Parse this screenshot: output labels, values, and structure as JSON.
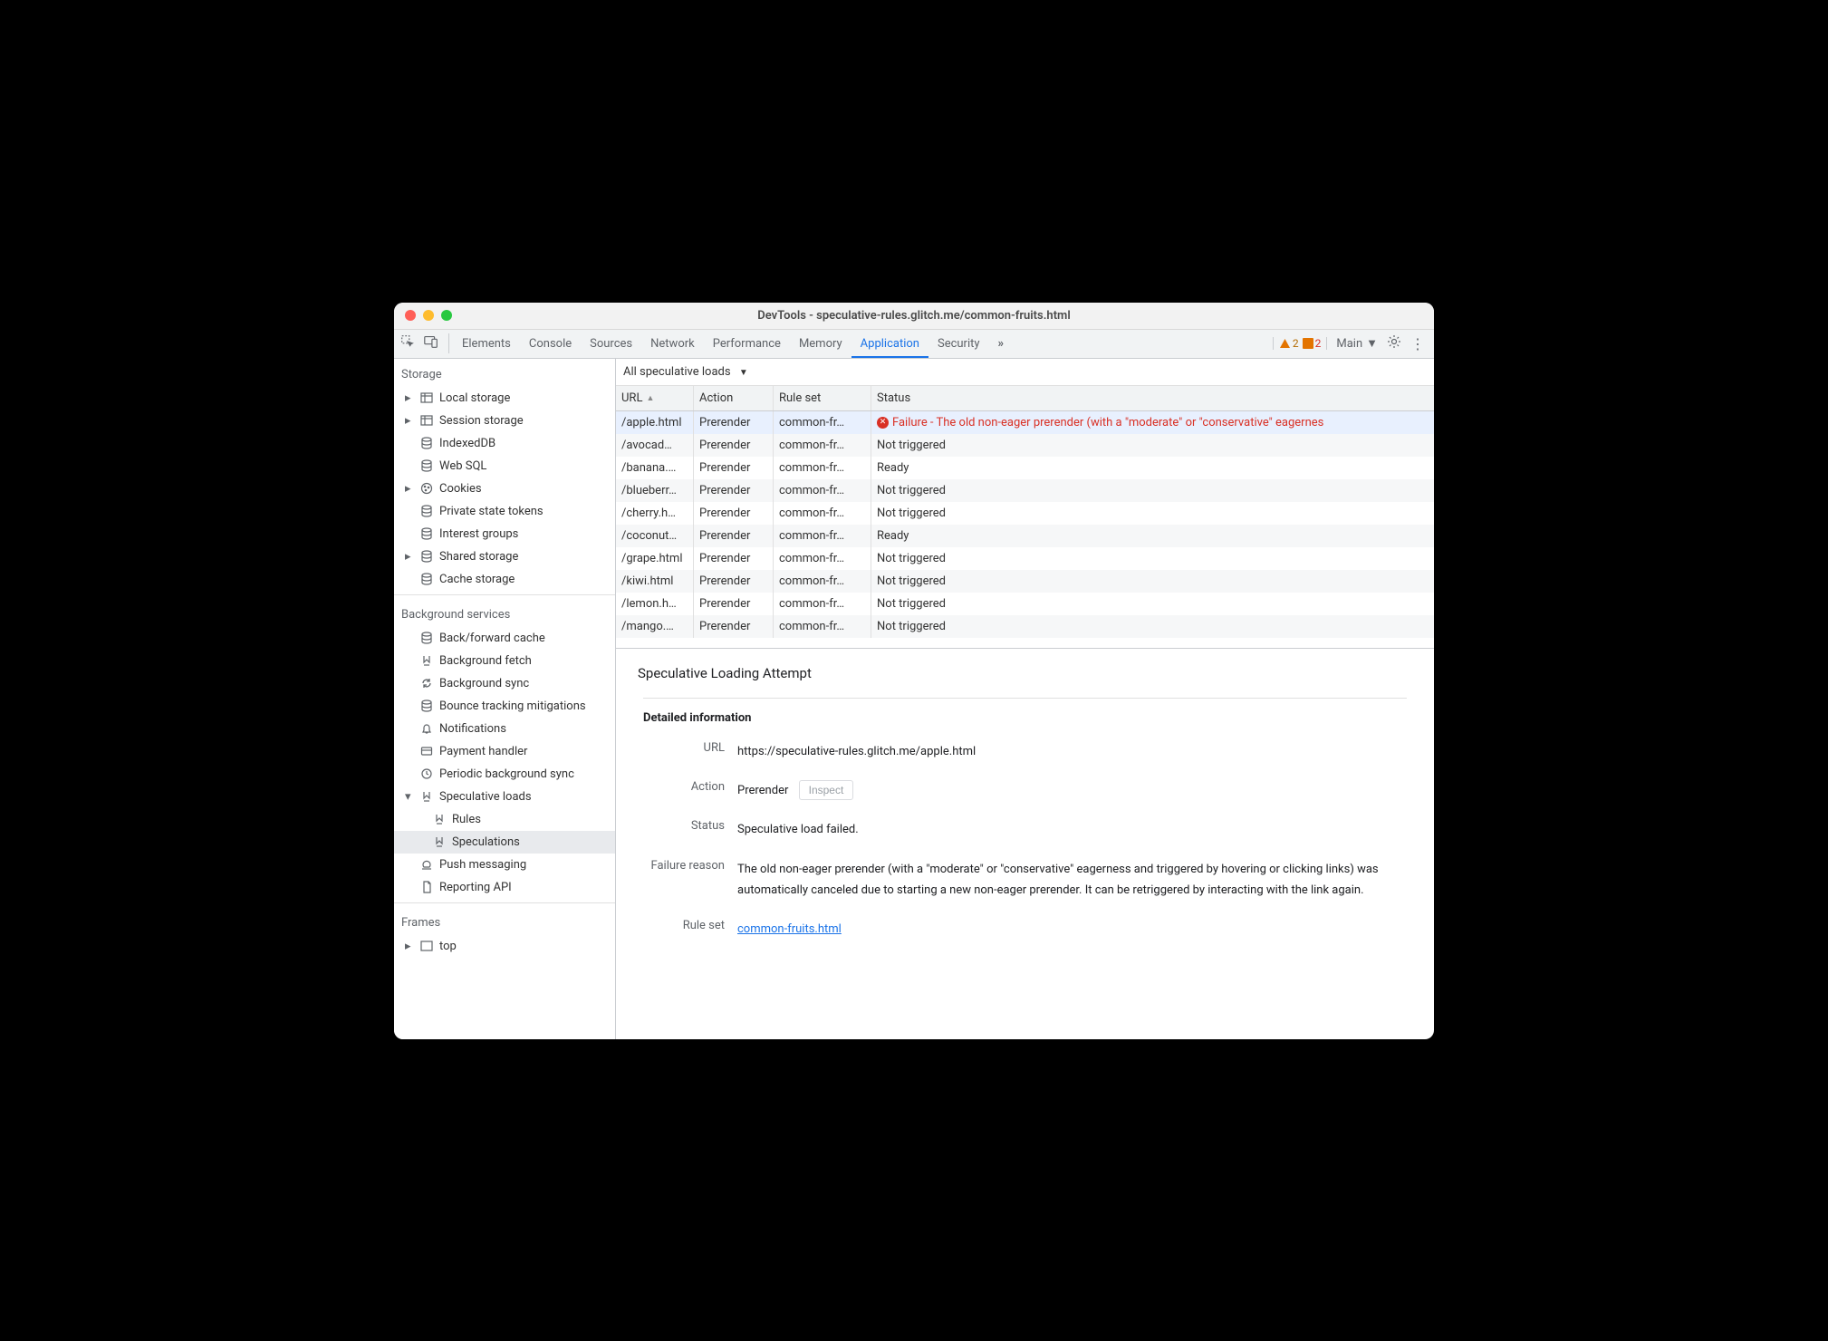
{
  "window_title": "DevTools - speculative-rules.glitch.me/common-fruits.html",
  "toolbar": {
    "tabs": [
      "Elements",
      "Console",
      "Sources",
      "Network",
      "Performance",
      "Memory",
      "Application",
      "Security"
    ],
    "active_tab": "Application",
    "warnings": "2",
    "errors": "2",
    "main_label": "Main"
  },
  "sidebar": {
    "storage": {
      "header": "Storage",
      "items": [
        {
          "label": "Local storage",
          "expandable": true
        },
        {
          "label": "Session storage",
          "expandable": true
        },
        {
          "label": "IndexedDB",
          "expandable": false
        },
        {
          "label": "Web SQL",
          "expandable": false
        },
        {
          "label": "Cookies",
          "expandable": true
        },
        {
          "label": "Private state tokens",
          "expandable": false
        },
        {
          "label": "Interest groups",
          "expandable": false
        },
        {
          "label": "Shared storage",
          "expandable": true
        },
        {
          "label": "Cache storage",
          "expandable": false
        }
      ]
    },
    "bgservices": {
      "header": "Background services",
      "items": [
        {
          "label": "Back/forward cache"
        },
        {
          "label": "Background fetch"
        },
        {
          "label": "Background sync"
        },
        {
          "label": "Bounce tracking mitigations"
        },
        {
          "label": "Notifications"
        },
        {
          "label": "Payment handler"
        },
        {
          "label": "Periodic background sync"
        },
        {
          "label": "Speculative loads",
          "expanded": true,
          "children": [
            "Rules",
            "Speculations"
          ]
        },
        {
          "label": "Push messaging"
        },
        {
          "label": "Reporting API"
        }
      ],
      "selected": "Speculations"
    },
    "frames": {
      "header": "Frames",
      "items": [
        {
          "label": "top"
        }
      ]
    }
  },
  "filter_label": "All speculative loads",
  "table": {
    "headers": {
      "url": "URL",
      "action": "Action",
      "ruleset": "Rule set",
      "status": "Status"
    },
    "rows": [
      {
        "url": "/apple.html",
        "action": "Prerender",
        "ruleset": "common-fr…",
        "status": "Failure - The old non-eager prerender (with a \"moderate\" or \"conservative\" eagernes",
        "error": true,
        "selected": true
      },
      {
        "url": "/avocad…",
        "action": "Prerender",
        "ruleset": "common-fr…",
        "status": "Not triggered"
      },
      {
        "url": "/banana.…",
        "action": "Prerender",
        "ruleset": "common-fr…",
        "status": "Ready"
      },
      {
        "url": "/blueberr…",
        "action": "Prerender",
        "ruleset": "common-fr…",
        "status": "Not triggered"
      },
      {
        "url": "/cherry.h…",
        "action": "Prerender",
        "ruleset": "common-fr…",
        "status": "Not triggered"
      },
      {
        "url": "/coconut…",
        "action": "Prerender",
        "ruleset": "common-fr…",
        "status": "Ready"
      },
      {
        "url": "/grape.html",
        "action": "Prerender",
        "ruleset": "common-fr…",
        "status": "Not triggered"
      },
      {
        "url": "/kiwi.html",
        "action": "Prerender",
        "ruleset": "common-fr…",
        "status": "Not triggered"
      },
      {
        "url": "/lemon.h…",
        "action": "Prerender",
        "ruleset": "common-fr…",
        "status": "Not triggered"
      },
      {
        "url": "/mango.…",
        "action": "Prerender",
        "ruleset": "common-fr…",
        "status": "Not triggered"
      }
    ]
  },
  "detail": {
    "title": "Speculative Loading Attempt",
    "subtitle": "Detailed information",
    "rows": {
      "url": {
        "label": "URL",
        "value": "https://speculative-rules.glitch.me/apple.html"
      },
      "action": {
        "label": "Action",
        "value": "Prerender",
        "inspect": "Inspect"
      },
      "status": {
        "label": "Status",
        "value": "Speculative load failed."
      },
      "failure": {
        "label": "Failure reason",
        "value": "The old non-eager prerender (with a \"moderate\" or \"conservative\" eagerness and triggered by hovering or clicking links) was automatically canceled due to starting a new non-eager prerender. It can be retriggered by interacting with the link again."
      },
      "ruleset": {
        "label": "Rule set",
        "value": "common-fruits.html"
      }
    }
  }
}
